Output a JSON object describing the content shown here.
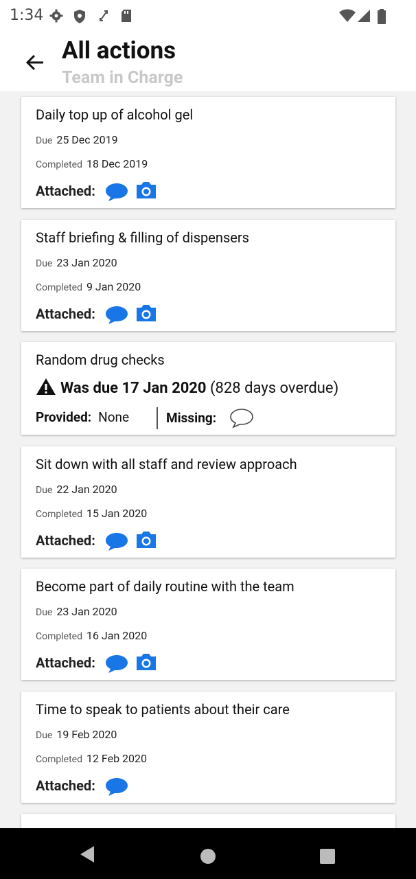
{
  "status_bar": {
    "time": "1:34"
  },
  "header": {
    "title": "All actions",
    "subtitle": "Team in Charge"
  },
  "cards": [
    {
      "title": "Daily top up of alcohol gel",
      "due_label": "Due",
      "due": "25 Dec 2019",
      "completed_label": "Completed",
      "completed": "18 Dec 2019",
      "attached_label": "Attached:",
      "attachments": [
        "chat-bubble-icon",
        "camera-icon"
      ]
    },
    {
      "title": "Staff briefing & filling of dispensers",
      "due_label": "Due",
      "due": "23 Jan 2020",
      "completed_label": "Completed",
      "completed": "9 Jan 2020",
      "attached_label": "Attached:",
      "attachments": [
        "chat-bubble-icon",
        "camera-icon"
      ]
    },
    {
      "title": "Random drug checks",
      "overdue_prefix": "Was due 17 Jan 2020",
      "overdue_suffix": "(828 days overdue)",
      "provided_label": "Provided:",
      "provided_value": "None",
      "missing_label": "Missing:"
    },
    {
      "title": "Sit down with all staff and review approach",
      "due_label": "Due",
      "due": "22 Jan 2020",
      "completed_label": "Completed",
      "completed": "15 Jan 2020",
      "attached_label": "Attached:",
      "attachments": [
        "chat-bubble-icon",
        "camera-icon"
      ]
    },
    {
      "title": "Become part of daily routine with the team",
      "due_label": "Due",
      "due": "23 Jan 2020",
      "completed_label": "Completed",
      "completed": "16 Jan 2020",
      "attached_label": "Attached:",
      "attachments": [
        "chat-bubble-icon",
        "camera-icon"
      ]
    },
    {
      "title": "Time to speak to patients about their care",
      "due_label": "Due",
      "due": "19 Feb 2020",
      "completed_label": "Completed",
      "completed": "12 Feb 2020",
      "attached_label": "Attached:",
      "attachments": [
        "chat-bubble-icon"
      ]
    }
  ],
  "colors": {
    "accent": "#1976e6",
    "header_bg": "#ffffff",
    "list_bg": "#f2f2f2",
    "subtitle": "#c8c8c8"
  }
}
